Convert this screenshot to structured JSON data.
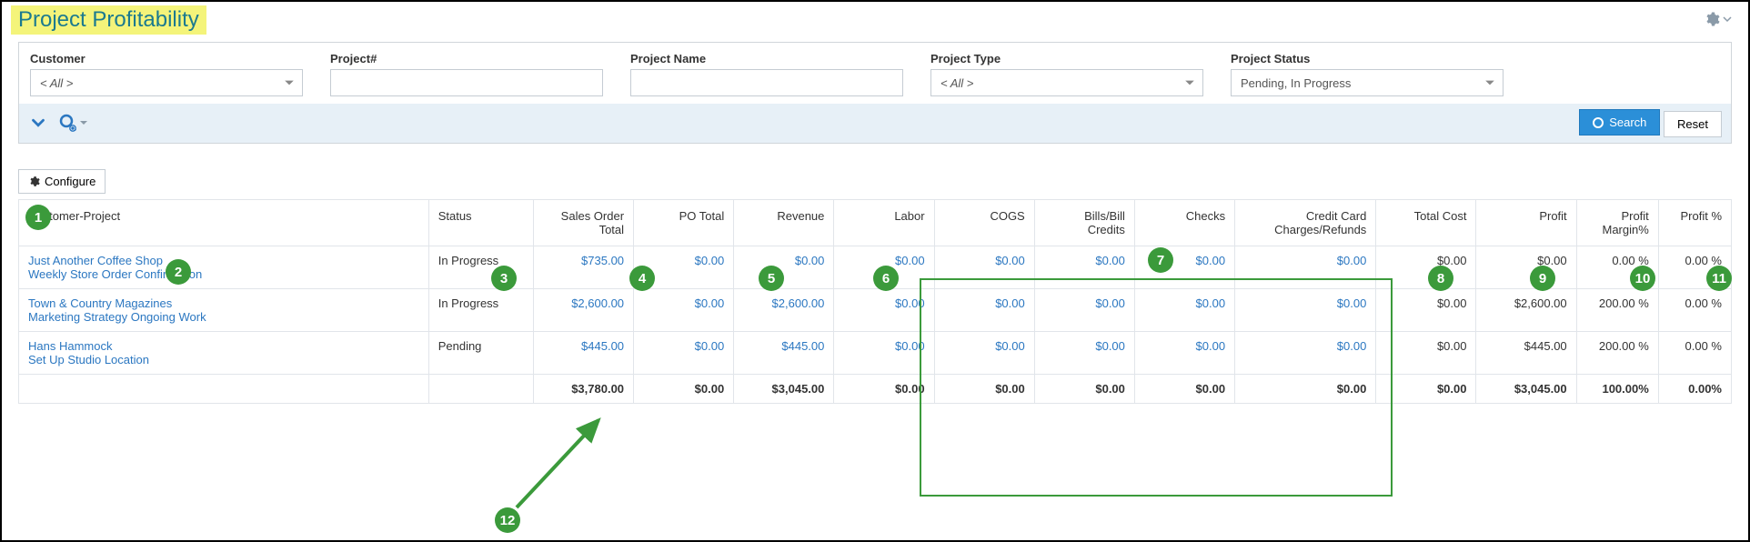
{
  "page": {
    "title": "Project Profitability"
  },
  "filters": {
    "customer": {
      "label": "Customer",
      "value": "< All >"
    },
    "projectNum": {
      "label": "Project#",
      "value": ""
    },
    "projectName": {
      "label": "Project Name",
      "value": ""
    },
    "projectType": {
      "label": "Project Type",
      "value": "< All >"
    },
    "projectStatus": {
      "label": "Project Status",
      "value": "Pending, In Progress"
    }
  },
  "buttons": {
    "search": "Search",
    "reset": "Reset",
    "configure": "Configure"
  },
  "columns": {
    "custProject": "Customer-Project",
    "status": "Status",
    "salesOrderTotal": "Sales Order Total",
    "poTotal": "PO Total",
    "revenue": "Revenue",
    "labor": "Labor",
    "cogs": "COGS",
    "billsCredits": "Bills/Bill Credits",
    "checks": "Checks",
    "ccCharges": "Credit Card Charges/Refunds",
    "totalCost": "Total Cost",
    "profit": "Profit",
    "profitMargin": "Profit Margin%",
    "profitPct": "Profit %"
  },
  "rows": [
    {
      "customer": "Just Another Coffee Shop",
      "project": "Weekly Store Order Confirmation",
      "status": "In Progress",
      "salesOrderTotal": "$735.00",
      "poTotal": "$0.00",
      "revenue": "$0.00",
      "labor": "$0.00",
      "cogs": "$0.00",
      "billsCredits": "$0.00",
      "checks": "$0.00",
      "ccCharges": "$0.00",
      "totalCost": "$0.00",
      "profit": "$0.00",
      "profitMargin": "0.00 %",
      "profitPct": "0.00 %"
    },
    {
      "customer": "Town & Country Magazines",
      "project": "Marketing Strategy Ongoing Work",
      "status": "In Progress",
      "salesOrderTotal": "$2,600.00",
      "poTotal": "$0.00",
      "revenue": "$2,600.00",
      "labor": "$0.00",
      "cogs": "$0.00",
      "billsCredits": "$0.00",
      "checks": "$0.00",
      "ccCharges": "$0.00",
      "totalCost": "$0.00",
      "profit": "$2,600.00",
      "profitMargin": "200.00 %",
      "profitPct": "0.00 %"
    },
    {
      "customer": "Hans Hammock",
      "project": "Set Up Studio Location",
      "status": "Pending",
      "salesOrderTotal": "$445.00",
      "poTotal": "$0.00",
      "revenue": "$445.00",
      "labor": "$0.00",
      "cogs": "$0.00",
      "billsCredits": "$0.00",
      "checks": "$0.00",
      "ccCharges": "$0.00",
      "totalCost": "$0.00",
      "profit": "$445.00",
      "profitMargin": "200.00 %",
      "profitPct": "0.00 %"
    }
  ],
  "totals": {
    "salesOrderTotal": "$3,780.00",
    "poTotal": "$0.00",
    "revenue": "$3,045.00",
    "labor": "$0.00",
    "cogs": "$0.00",
    "billsCredits": "$0.00",
    "checks": "$0.00",
    "ccCharges": "$0.00",
    "totalCost": "$0.00",
    "profit": "$3,045.00",
    "profitMargin": "100.00%",
    "profitPct": "0.00%"
  },
  "annotations": {
    "b1": "1",
    "b2": "2",
    "b3": "3",
    "b4": "4",
    "b5": "5",
    "b6": "6",
    "b7": "7",
    "b8": "8",
    "b9": "9",
    "b10": "10",
    "b11": "11",
    "b12": "12"
  }
}
